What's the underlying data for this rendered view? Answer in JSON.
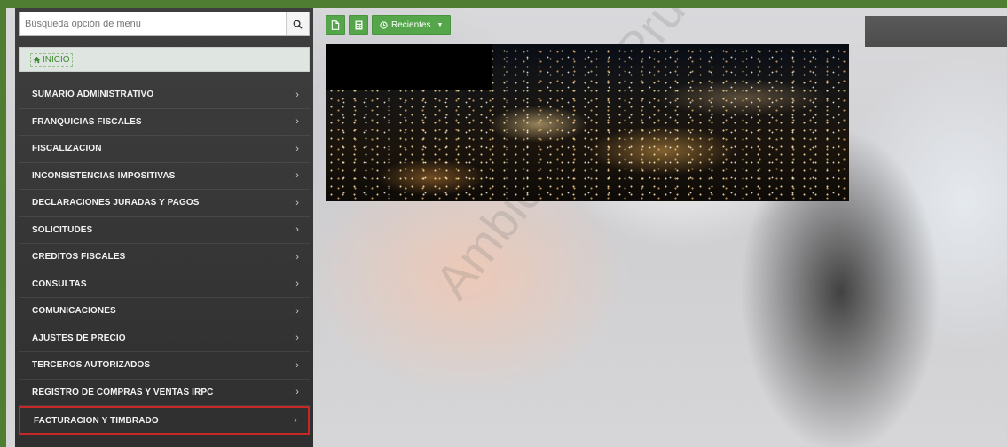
{
  "search": {
    "placeholder": "Búsqueda opción de menú",
    "icon": "search-icon"
  },
  "home": {
    "label": "INICIO",
    "icon": "home-icon"
  },
  "menu": {
    "items": [
      {
        "label": "SUMARIO ADMINISTRATIVO"
      },
      {
        "label": "FRANQUICIAS FISCALES"
      },
      {
        "label": "FISCALIZACION"
      },
      {
        "label": "INCONSISTENCIAS IMPOSITIVAS"
      },
      {
        "label": "DECLARACIONES JURADAS Y PAGOS"
      },
      {
        "label": "SOLICITUDES"
      },
      {
        "label": "CREDITOS FISCALES"
      },
      {
        "label": "CONSULTAS"
      },
      {
        "label": "COMUNICACIONES"
      },
      {
        "label": "AJUSTES DE PRECIO"
      },
      {
        "label": "TERCEROS AUTORIZADOS"
      },
      {
        "label": "REGISTRO DE COMPRAS Y VENTAS IRPC"
      },
      {
        "label": "FACTURACION Y TIMBRADO",
        "highlighted": true
      }
    ],
    "chevron": "›"
  },
  "toolbar": {
    "new_icon": "document-icon",
    "calc_icon": "calculator-icon",
    "recent_label": "Recientes",
    "recent_icon": "clock-icon"
  },
  "watermark": "Ambiente de Pruebas",
  "colors": {
    "frame": "#4f7d32",
    "accent_green": "#55a64a",
    "highlight_red": "#c62828",
    "sidebar": "#3a3a3a"
  }
}
